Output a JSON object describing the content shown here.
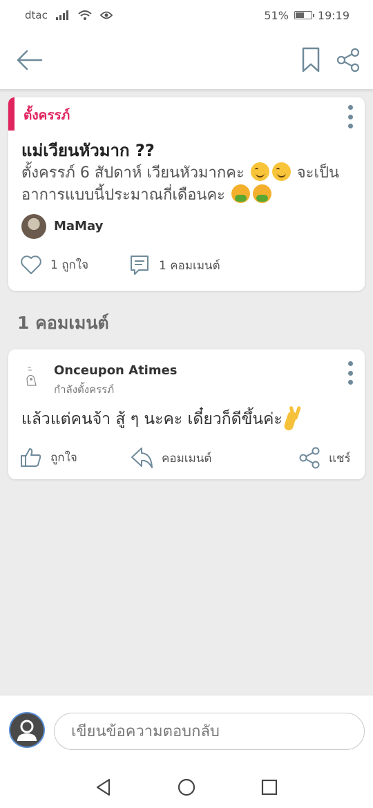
{
  "status_bar": {
    "carrier": "dtac",
    "battery_percent": "51%",
    "battery_level": 0.51,
    "time": "19:19"
  },
  "post": {
    "tag": "ตั้งครรภ์",
    "title": "แม่เวียนหัวมาก ??",
    "body_part1": "ตั้งครรภ์ 6 สัปดาห์ เวียนหัวมากคะ",
    "body_part2": "จะเป็นอาการแบบนี้ประมาณกี่เดือนคะ",
    "author": "MaMay",
    "like_label": "1 ถูกใจ",
    "comment_label": "1 คอมเมนต์"
  },
  "comments_heading": "1 คอมเมนต์",
  "comment": {
    "author": "Onceupon Atimes",
    "status": "กำลังตั้งครรภ์",
    "text": "แล้วแต่คนจ้า สู้ ๆ นะคะ เดี๋ยวก็ดีขึ้นค่ะ",
    "like_label": "ถูกใจ",
    "reply_label": "คอมเมนต์",
    "share_label": "แชร์"
  },
  "reply": {
    "placeholder": "เขียนข้อความตอบกลับ"
  },
  "colors": {
    "accent": "#e0245e",
    "icon": "#6f8a9a",
    "background": "#ececec"
  }
}
